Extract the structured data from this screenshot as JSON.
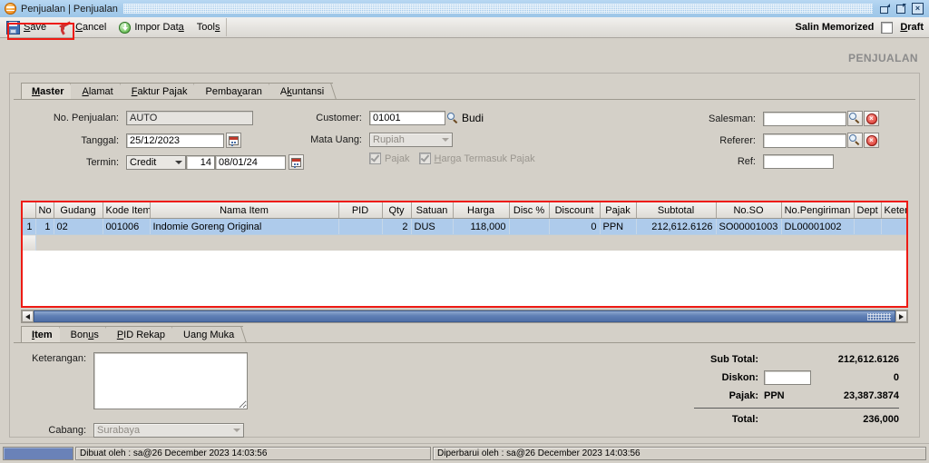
{
  "window": {
    "title": "Penjualan | Penjualan",
    "icon": "app-logo-icon",
    "controls": {
      "restore": "restore-icon",
      "maximize": "maximize-icon",
      "close": "×"
    }
  },
  "toolbar": {
    "save_label": "Save",
    "cancel_label": "Cancel",
    "import_label": "Impor Data",
    "tools_label": "Tools",
    "salin_memorized_label": "Salin Memorized",
    "draft_label": "Draft",
    "draft_checked": false
  },
  "page_title": "PENJUALAN",
  "tabs": [
    {
      "label": "Master",
      "active": true
    },
    {
      "label": "Alamat",
      "active": false
    },
    {
      "label": "Faktur Pajak",
      "active": false
    },
    {
      "label": "Pembayaran",
      "active": false
    },
    {
      "label": "Akuntansi",
      "active": false
    }
  ],
  "form": {
    "no_penjualan_label": "No. Penjualan:",
    "no_penjualan_value": "AUTO",
    "tanggal_label": "Tanggal:",
    "tanggal_value": "25/12/2023",
    "termin_label": "Termin:",
    "termin_value": "Credit",
    "termin_days": "14",
    "termin_date": "08/01/24",
    "customer_label": "Customer:",
    "customer_value": "01001",
    "customer_name": "Budi",
    "mata_uang_label": "Mata Uang:",
    "mata_uang_value": "Rupiah",
    "pajak_label": "Pajak",
    "pajak_checked": true,
    "harga_termasuk_pajak_label": "Harga Termasuk Pajak",
    "harga_termasuk_pajak_checked": true,
    "salesman_label": "Salesman:",
    "salesman_value": "",
    "referer_label": "Referer:",
    "referer_value": "",
    "ref_label": "Ref:",
    "ref_value": ""
  },
  "grid": {
    "columns": [
      "No",
      "Gudang",
      "Kode Item",
      "Nama Item",
      "PID",
      "Qty",
      "Satuan",
      "Harga",
      "Disc %",
      "Discount",
      "Pajak",
      "Subtotal",
      "No.SO",
      "No.Pengiriman",
      "Dept",
      "Keterangan"
    ],
    "rows": [
      {
        "row_header": "1",
        "no": "1",
        "gudang": "02",
        "kode_item": "001006",
        "nama_item": "Indomie Goreng Original",
        "pid": "",
        "qty": "2",
        "satuan": "DUS",
        "harga": "118,000",
        "disc_pct": "",
        "discount": "0",
        "pajak": "PPN",
        "subtotal": "212,612.6126",
        "no_so": "SO00001003",
        "no_pengiriman": "DL00001002",
        "dept": "",
        "keterangan": ""
      }
    ]
  },
  "bottom_tabs": [
    {
      "label": "Item",
      "active": true
    },
    {
      "label": "Bonus",
      "active": false
    },
    {
      "label": "PID Rekap",
      "active": false
    },
    {
      "label": "Uang Muka",
      "active": false
    }
  ],
  "bottom_form": {
    "keterangan_label": "Keterangan:",
    "keterangan_value": "",
    "cabang_label": "Cabang:",
    "cabang_value": "Surabaya"
  },
  "totals": {
    "sub_total_label": "Sub Total:",
    "sub_total_value": "212,612.6126",
    "diskon_label": "Diskon:",
    "diskon_input": "",
    "diskon_value": "0",
    "pajak_label": "Pajak:",
    "pajak_type": "PPN",
    "pajak_value": "23,387.3874",
    "total_label": "Total:",
    "total_value": "236,000"
  },
  "statusbar": {
    "created": "Dibuat oleh : sa@26 December 2023  14:03:56",
    "updated": "Diperbarui oleh : sa@26 December 2023  14:03:56"
  },
  "colors": {
    "highlight_red": "#ee1b14",
    "row_selected": "#aecbeb",
    "title_blue": "#a8cdec",
    "scrollbar_blue": "#5f7fb5"
  }
}
